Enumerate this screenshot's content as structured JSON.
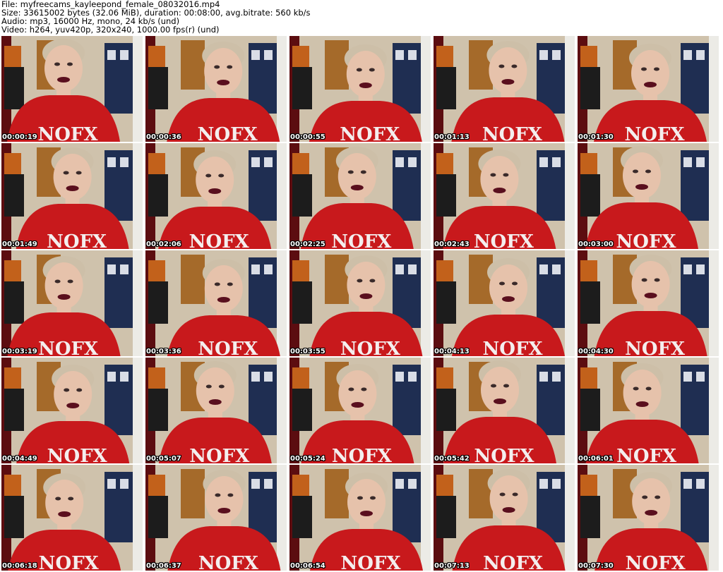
{
  "header": {
    "file": "File: myfreecams_kayleepond_female_08032016.mp4",
    "size": "Size: 33615002 bytes (32.06 MiB), duration: 00:08:00, avg.bitrate: 560 kb/s",
    "audio": "Audio: mp3, 16000 Hz, mono, 24 kb/s (und)",
    "video": "Video: h264, yuv420p, 320x240, 1000.00 fps(r) (und)"
  },
  "thumb_shirt_text": "NOFX",
  "thumbnails": [
    {
      "time": "00:00:19"
    },
    {
      "time": "00:00:36"
    },
    {
      "time": "00:00:55"
    },
    {
      "time": "00:01:13"
    },
    {
      "time": "00:01:30"
    },
    {
      "time": "00:01:49"
    },
    {
      "time": "00:02:06"
    },
    {
      "time": "00:02:25"
    },
    {
      "time": "00:02:43"
    },
    {
      "time": "00:03:00"
    },
    {
      "time": "00:03:19"
    },
    {
      "time": "00:03:36"
    },
    {
      "time": "00:03:55"
    },
    {
      "time": "00:04:13"
    },
    {
      "time": "00:04:30"
    },
    {
      "time": "00:04:49"
    },
    {
      "time": "00:05:07"
    },
    {
      "time": "00:05:24"
    },
    {
      "time": "00:05:42"
    },
    {
      "time": "00:06:01"
    },
    {
      "time": "00:06:18"
    },
    {
      "time": "00:06:37"
    },
    {
      "time": "00:06:54"
    },
    {
      "time": "00:07:13"
    },
    {
      "time": "00:07:30"
    }
  ],
  "colors": {
    "background": "#ffffff",
    "shirt_red": "#c8191c",
    "skin": "#e6c2ab",
    "hair": "#cdbfa8",
    "curtain": "#5c0d10",
    "wall": "#cfc2ac",
    "door": "#a56a2a",
    "box": "#1f2e52",
    "shelf": "#1c1c1c",
    "lips": "#5a0f1e",
    "timestamp_text": "#ffffff",
    "timestamp_outline": "#000000"
  }
}
